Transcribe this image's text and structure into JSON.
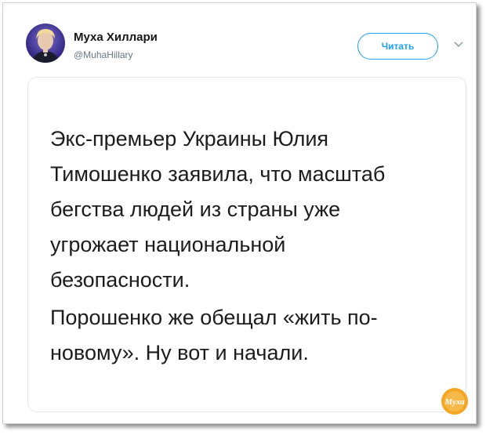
{
  "tweet": {
    "author_name": "Муха Хиллари",
    "author_handle": "@MuhaHillary",
    "follow_label": "Читать",
    "image_text": {
      "paragraph1_lines": [
        "Экс-премьер Украины Юлия",
        "Тимошенко заявила, что масштаб",
        "бегства людей из страны уже",
        "угрожает национальной",
        "безопасности."
      ],
      "paragraph2_lines": [
        "Порошенко же обещал «жить по-",
        "новому». Ну вот и начали."
      ]
    }
  },
  "watermark": {
    "text": "Муха"
  },
  "icons": {
    "avatar": "avatar-photo",
    "caret": "chevron-down-icon",
    "watermark": "muha-logo"
  },
  "colors": {
    "accent": "#1da1f2",
    "text": "#14171a",
    "muted": "#657786",
    "watermark": "#f5a623"
  }
}
